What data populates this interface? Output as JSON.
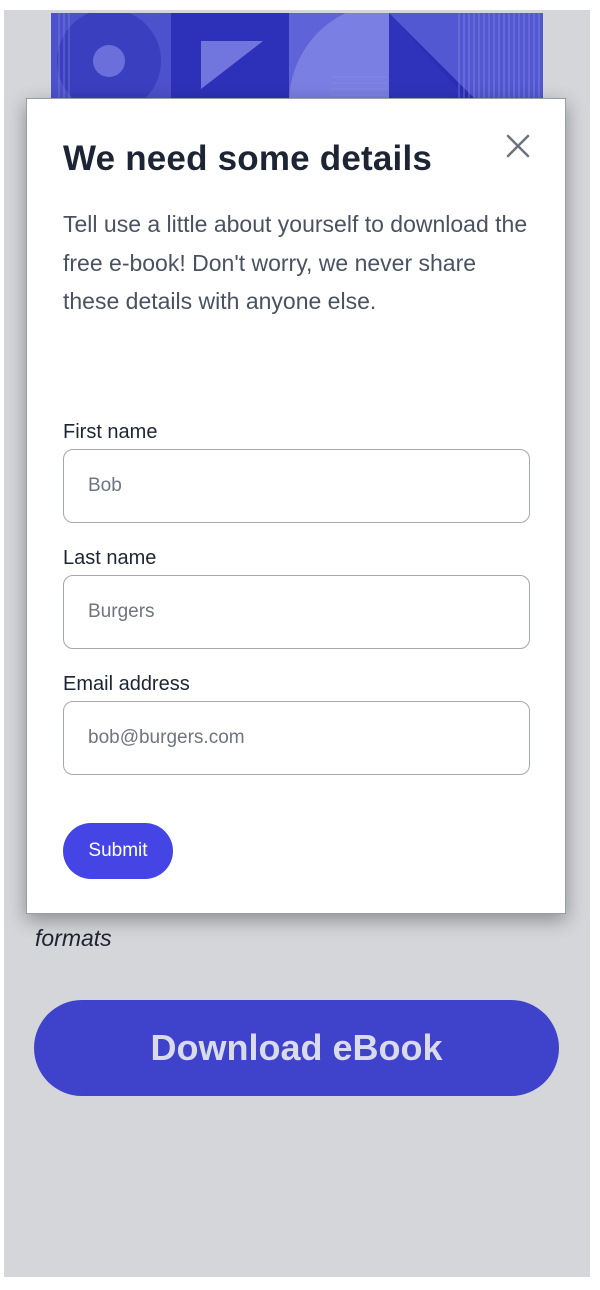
{
  "hero": {
    "image": "abstract-geometric-cover-art",
    "colors": {
      "base": "#5a5fd4",
      "dark": "#2c2fb8",
      "light": "#7b80e2"
    }
  },
  "page": {
    "formats_text": "formats",
    "download_button_label": "Download eBook",
    "background_color": "#d5d6da",
    "accent_color": "#3f43cc"
  },
  "modal": {
    "title": "We need some details",
    "description": "Tell use a little about yourself to download the free e-book! Don't worry, we never share these details with anyone else.",
    "close_icon": "close-icon",
    "fields": {
      "first_name": {
        "label": "First name",
        "placeholder": "Bob",
        "value": ""
      },
      "last_name": {
        "label": "Last name",
        "placeholder": "Burgers",
        "value": ""
      },
      "email": {
        "label": "Email address",
        "placeholder": "bob@burgers.com",
        "value": ""
      }
    },
    "submit_label": "Submit",
    "submit_color": "#4545e5"
  }
}
